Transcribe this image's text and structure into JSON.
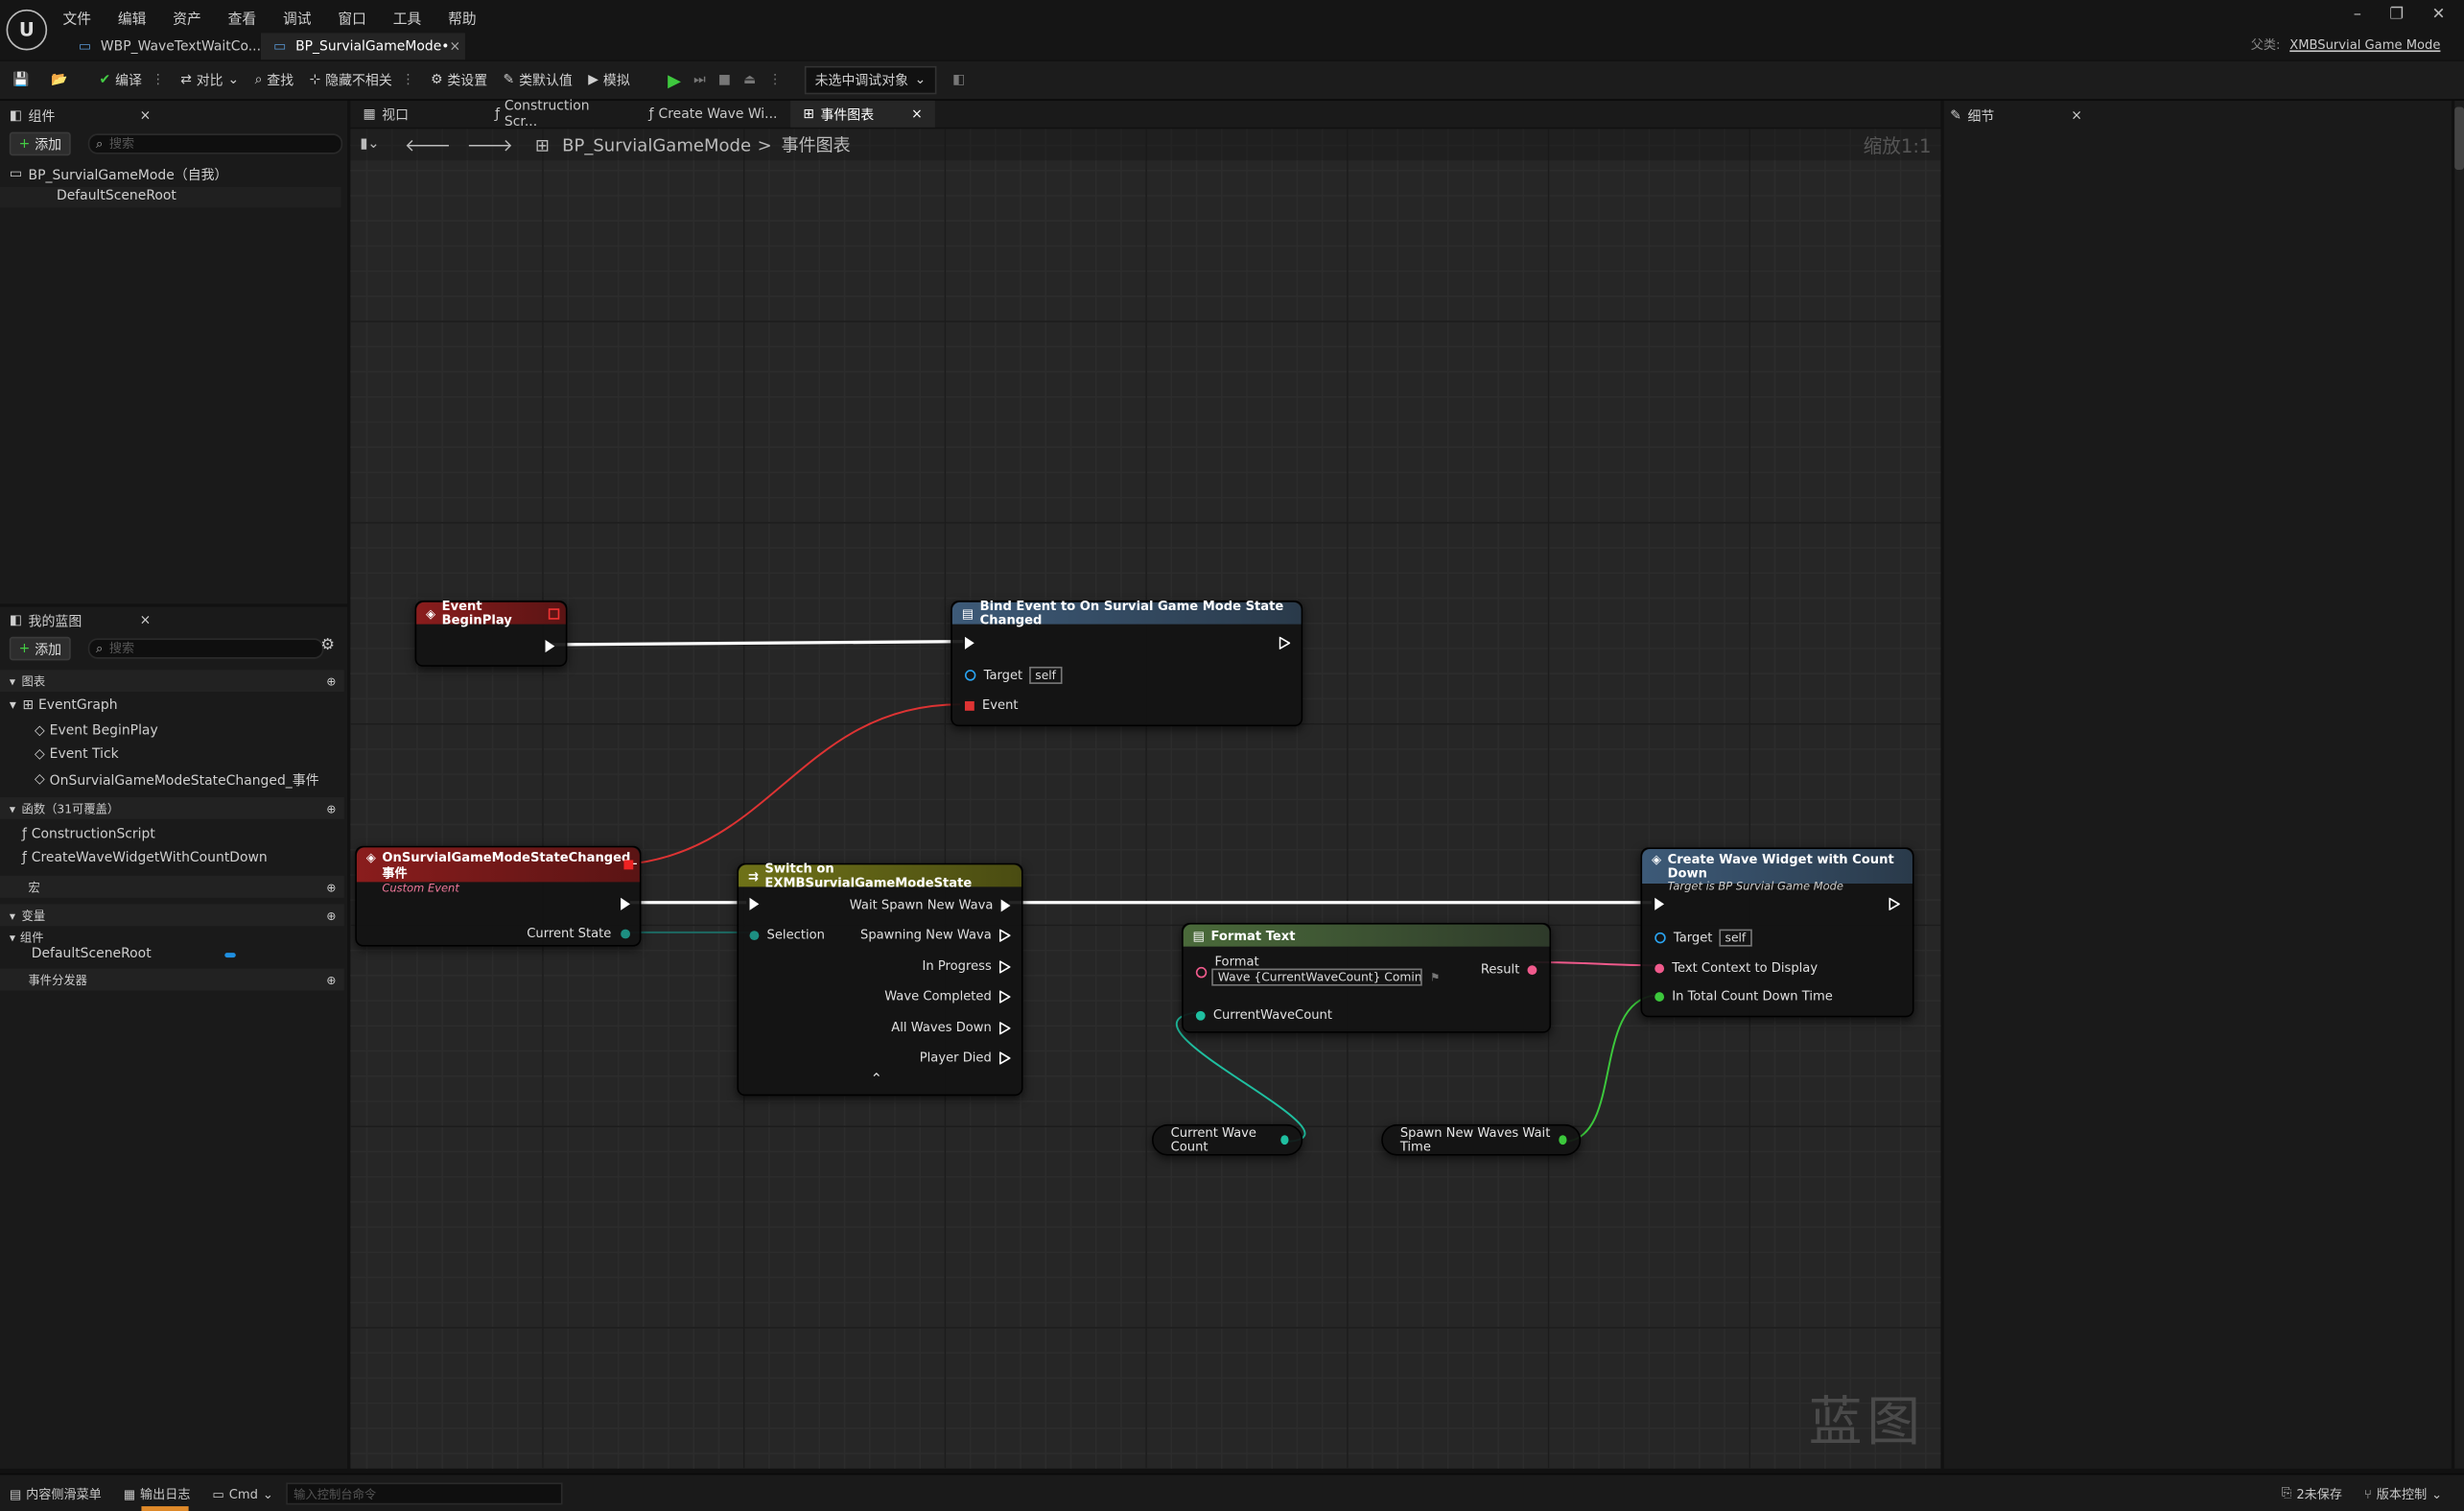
{
  "menu": [
    "文件",
    "编辑",
    "资产",
    "查看",
    "调试",
    "窗口",
    "工具",
    "帮助"
  ],
  "tabs": [
    {
      "label": "WBP_WaveTextWaitCo...•",
      "active": false
    },
    {
      "label": "BP_SurvialGameMode•",
      "active": true
    }
  ],
  "parent": {
    "label": "父类:",
    "value": "XMBSurvial Game Mode"
  },
  "toolbar": {
    "compile": "编译",
    "diff": "对比",
    "find": "查找",
    "hide_unrelated": "隐藏不相关",
    "class_settings": "类设置",
    "class_defaults": "类默认值",
    "simulate": "模拟",
    "debug_target": "未选中调试对象"
  },
  "components_panel": {
    "title": "组件",
    "add": "添加",
    "search_placeholder": "搜索",
    "self_item": "BP_SurvialGameMode（自我）",
    "root": "DefaultSceneRoot"
  },
  "doc_tabs": [
    {
      "label": "视口"
    },
    {
      "label": "Construction Scr..."
    },
    {
      "label": "Create Wave Wi..."
    },
    {
      "label": "事件图表"
    }
  ],
  "details_panel": {
    "title": "细节"
  },
  "breadcrumb": {
    "blueprint": "BP_SurvialGameMode",
    "sep": ">",
    "graph": "事件图表"
  },
  "zoom_label": "缩放1:1",
  "watermark": "蓝图",
  "my_blueprint": {
    "title": "我的蓝图",
    "add": "添加",
    "search_placeholder": "搜索",
    "graphs_section": "图表",
    "event_graph": "EventGraph",
    "events": [
      "Event BeginPlay",
      "Event Tick",
      "OnSurvialGameModeStateChanged_事件"
    ],
    "functions_section": "函数（31可覆盖）",
    "functions": [
      "ConstructionScript",
      "CreateWaveWidgetWithCountDown"
    ],
    "macros_section": "宏",
    "variables_section": "变量",
    "components_sub": "组件",
    "variable_item": "DefaultSceneRoot",
    "dispatchers_section": "事件分发器"
  },
  "nodes": {
    "begin_play": {
      "title": "Event BeginPlay"
    },
    "bind_event": {
      "title": "Bind Event to On Survial Game Mode State Changed",
      "target": "Target",
      "target_val": "self",
      "event": "Event"
    },
    "custom_event": {
      "title": "OnSurvialGameModeStateChanged_事件",
      "subtitle": "Custom Event",
      "current_state": "Current State"
    },
    "switch": {
      "title": "Switch on EXMBSurvialGameModeState",
      "selection": "Selection",
      "outputs": [
        "Wait Spawn New Wava",
        "Spawning New Wava",
        "In Progress",
        "Wave Completed",
        "All Waves Down",
        "Player Died"
      ]
    },
    "format_text": {
      "title": "Format Text",
      "format": "Format",
      "format_val": "Wave {CurrentWaveCount} Coming In",
      "result": "Result",
      "current_wave_count": "CurrentWaveCount"
    },
    "create_widget": {
      "title": "Create Wave Widget with Count Down",
      "subtitle": "Target is BP Survial Game Mode",
      "target": "Target",
      "target_val": "self",
      "text_ctx": "Text Context to Display",
      "count_down": "In Total Count Down Time"
    },
    "var_wave_count": {
      "label": "Current Wave Count"
    },
    "var_wait_time": {
      "label": "Spawn New Waves Wait Time"
    }
  },
  "statusbar": {
    "content_drawer": "内容侧滑菜单",
    "output_log": "输出日志",
    "cmd": "Cmd",
    "cmd_placeholder": "输入控制台命令",
    "unsaved": "2未保存",
    "source_control": "版本控制"
  },
  "colors": {
    "exec": "#ffffff",
    "struct_pin": "#1fbfa0",
    "text_pin": "#f05a8c",
    "float_pin": "#3cc83c",
    "object_pin": "#2aa3f0",
    "event_head": "#8a1d1d",
    "func_head": "#3d5a78",
    "switch_head": "#6f7218",
    "pure_head": "#4a6a3a"
  }
}
